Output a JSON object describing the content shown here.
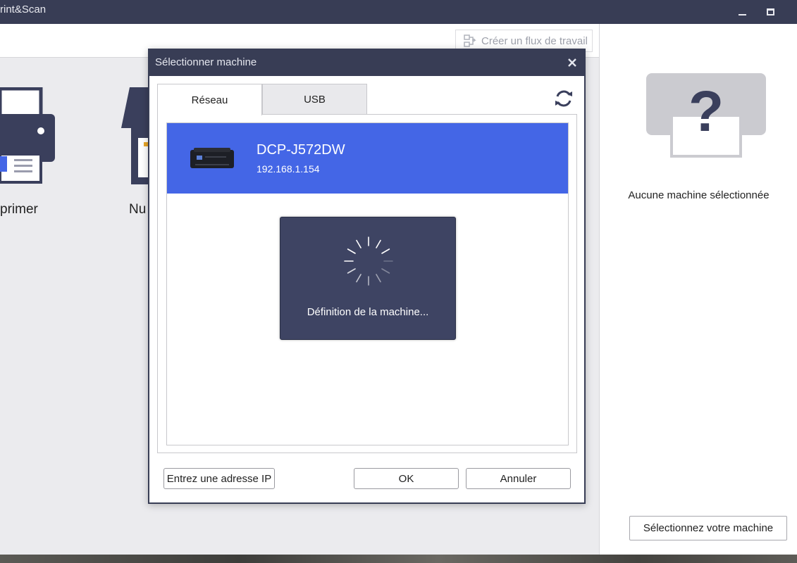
{
  "window": {
    "title": "rint&Scan"
  },
  "toolbar": {
    "workflow_label": "Créer un flux de travail"
  },
  "tiles": [
    {
      "label": "primer"
    },
    {
      "label": "Nu"
    }
  ],
  "right_panel": {
    "no_machine_label": "Aucune machine sélectionnée",
    "select_machine_label": "Sélectionnez votre machine"
  },
  "dialog": {
    "title": "Sélectionner machine",
    "tabs": [
      {
        "label": "Réseau",
        "active": true
      },
      {
        "label": "USB",
        "active": false
      }
    ],
    "devices": [
      {
        "name": "DCP-J572DW",
        "ip": "192.168.1.154",
        "selected": true
      }
    ],
    "progress_text": "Définition de la machine...",
    "buttons": {
      "enter_ip": "Entrez une adresse IP",
      "ok": "OK",
      "cancel": "Annuler"
    }
  },
  "colors": {
    "titlebar": "#383d55",
    "selection": "#4466e6",
    "overlay": "#3e4463",
    "icon_dark": "#3a3f5c"
  },
  "icons": {
    "window_minimize": "minimize-icon",
    "window_maximize": "maximize-icon",
    "workflow": "workflow-icon",
    "close": "close-icon",
    "refresh": "refresh-icon",
    "printer": "printer-icon",
    "scanner": "scanner-icon",
    "unknown_machine": "question-printer-icon",
    "spinner": "spinner-icon"
  }
}
